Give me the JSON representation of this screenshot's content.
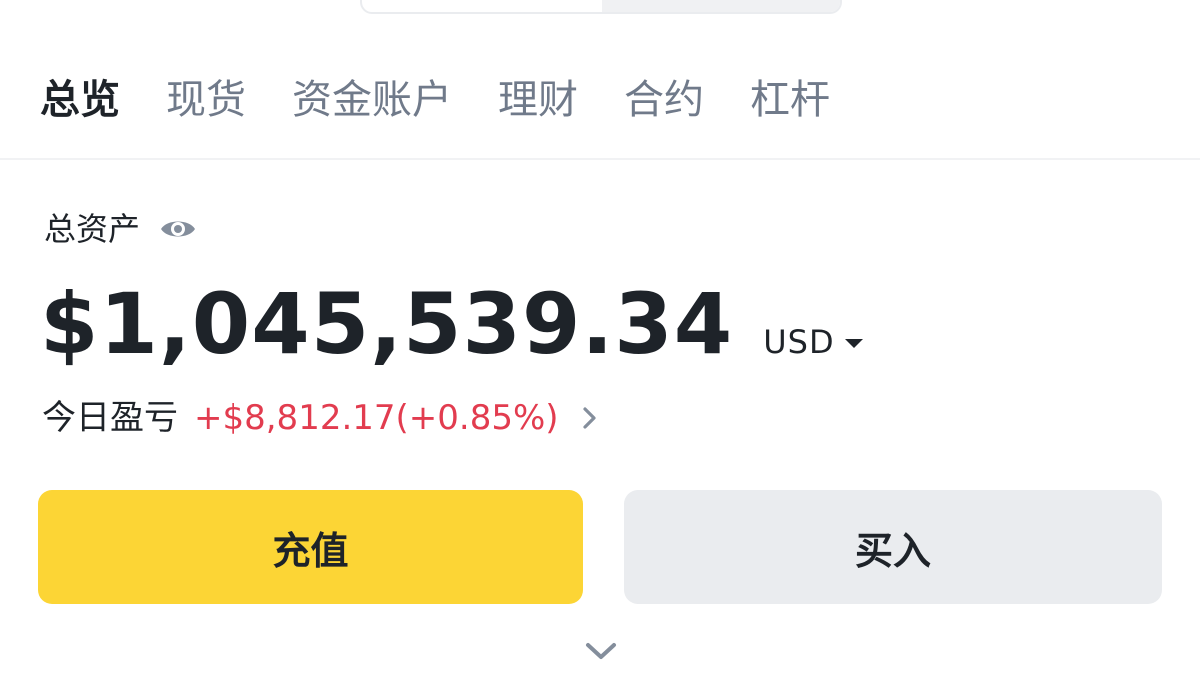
{
  "tabs": [
    {
      "label": "总览",
      "active": true
    },
    {
      "label": "现货",
      "active": false
    },
    {
      "label": "资金账户",
      "active": false
    },
    {
      "label": "理财",
      "active": false
    },
    {
      "label": "合约",
      "active": false
    },
    {
      "label": "杠杆",
      "active": false
    }
  ],
  "overview": {
    "total_assets_label": "总资产",
    "balance": "$1,045,539.34",
    "currency": "USD",
    "pnl_label": "今日盈亏",
    "pnl_value": "+$8,812.17(+0.85%)"
  },
  "actions": {
    "deposit_label": "充值",
    "buy_label": "买入"
  },
  "icons": {
    "visibility": "eye-icon",
    "currency_dropdown": "caret-down-icon",
    "pnl_detail": "chevron-right-icon",
    "expand": "chevron-down-icon"
  },
  "colors": {
    "primary_button": "#fcd535",
    "secondary_button": "#eaecef",
    "profit": "#e23c4f",
    "text_primary": "#1e2329",
    "text_secondary": "#707a8a"
  }
}
